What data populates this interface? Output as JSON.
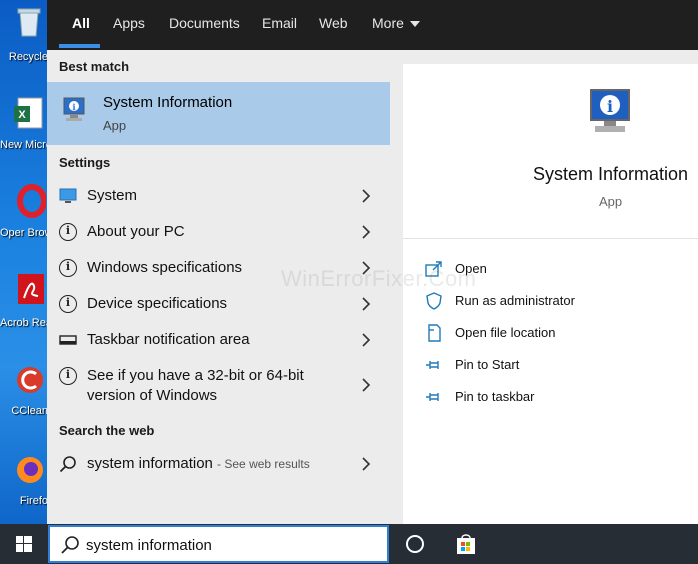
{
  "desktop": {
    "icons": [
      {
        "label": "Recycle",
        "icon": "recycle-bin-icon"
      },
      {
        "label": "New Microsof",
        "icon": "excel-file-icon"
      },
      {
        "label": "Oper Brows",
        "icon": "opera-icon"
      },
      {
        "label": "Acrob Reader",
        "icon": "acrobat-icon"
      },
      {
        "label": "CClean",
        "icon": "ccleaner-icon"
      },
      {
        "label": "Firefo",
        "icon": "firefox-icon"
      }
    ]
  },
  "tabs": [
    {
      "label": "All",
      "active": true
    },
    {
      "label": "Apps"
    },
    {
      "label": "Documents"
    },
    {
      "label": "Email"
    },
    {
      "label": "Web"
    },
    {
      "label": "More"
    }
  ],
  "best_match": {
    "heading": "Best match",
    "title": "System Information",
    "subtitle": "App",
    "icon": "system-information-icon"
  },
  "settings": {
    "heading": "Settings",
    "items": [
      {
        "label": "System",
        "icon": "monitor-icon"
      },
      {
        "label": "About your PC",
        "icon": "info-icon"
      },
      {
        "label": "Windows specifications",
        "icon": "info-icon"
      },
      {
        "label": "Device specifications",
        "icon": "info-icon"
      },
      {
        "label": "Taskbar notification area",
        "icon": "taskbar-icon"
      },
      {
        "label_line1": "See if you have a 32-bit or 64-bit",
        "label_line2": "version of Windows",
        "icon": "info-icon"
      }
    ]
  },
  "web": {
    "heading": "Search the web",
    "query": "system information",
    "hint": "- See web results"
  },
  "preview": {
    "title": "System Information",
    "subtitle": "App",
    "actions": [
      {
        "label": "Open",
        "icon": "open-icon"
      },
      {
        "label": "Run as administrator",
        "icon": "shield-icon"
      },
      {
        "label": "Open file location",
        "icon": "file-location-icon"
      },
      {
        "label": "Pin to Start",
        "icon": "pin-icon"
      },
      {
        "label": "Pin to taskbar",
        "icon": "pin-icon"
      }
    ]
  },
  "watermark": "WinErrorFixer.Com",
  "taskbar": {
    "search_value": "system information"
  },
  "colors": {
    "accent": "#2f7fd8",
    "best_match_bg": "#a9cbe9",
    "action_icon": "#1f7ab8"
  }
}
